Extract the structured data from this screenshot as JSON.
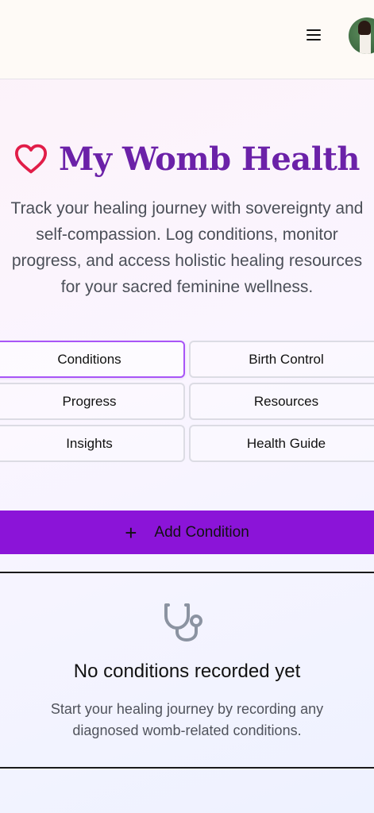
{
  "header": {
    "menu_icon": "hamburger-menu-icon",
    "avatar": "user-avatar"
  },
  "hero": {
    "icon": "heart-icon",
    "title": "My Womb Health",
    "subtitle_lines": [
      "Track your healing journey with sovereignty and",
      "self-compassion. Log conditions, monitor",
      "progress, and access holistic healing resources",
      "for your sacred feminine wellness."
    ]
  },
  "tabs": [
    {
      "label": "Conditions",
      "active": true
    },
    {
      "label": "Birth Control",
      "active": false
    },
    {
      "label": "Progress",
      "active": false
    },
    {
      "label": "Resources",
      "active": false
    },
    {
      "label": "Insights",
      "active": false
    },
    {
      "label": "Health Guide",
      "active": false
    }
  ],
  "actions": {
    "add_condition_label": "Add Condition",
    "add_icon": "plus-icon"
  },
  "empty_state": {
    "icon": "stethoscope-icon",
    "title": "No conditions recorded yet",
    "description_lines": [
      "Start your healing journey by recording any",
      "diagnosed womb-related conditions."
    ]
  },
  "colors": {
    "brand_purple": "#6b21a8",
    "button_purple": "#8b14d8",
    "heart_pink": "#e11d48",
    "active_tab_border": "#a855f7"
  }
}
